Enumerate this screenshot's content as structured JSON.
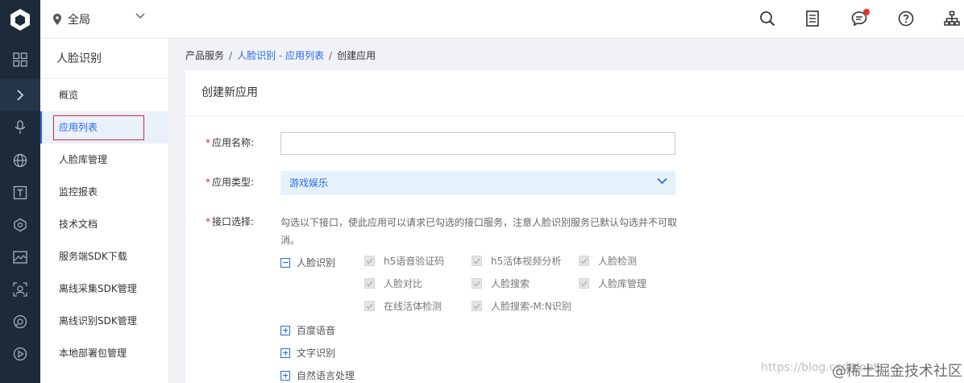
{
  "header": {
    "region": "全局",
    "icons": [
      "search-icon",
      "document-icon",
      "message-icon",
      "help-icon",
      "sitemap-icon"
    ]
  },
  "rail": {
    "icons": [
      "grid-icon",
      "expand-icon",
      "microphone-icon",
      "globe-icon",
      "text-icon",
      "cube-icon",
      "image-icon",
      "face-scan-icon",
      "eye-icon",
      "video-icon"
    ]
  },
  "sidenav": {
    "title": "人脸识别",
    "items": [
      {
        "label": "概览"
      },
      {
        "label": "应用列表",
        "active": true
      },
      {
        "label": "人脸库管理"
      },
      {
        "label": "监控报表"
      },
      {
        "label": "技术文档"
      },
      {
        "label": "服务端SDK下载"
      },
      {
        "label": "离线采集SDK管理"
      },
      {
        "label": "离线识别SDK管理"
      },
      {
        "label": "本地部署包管理"
      }
    ]
  },
  "breadcrumb": {
    "root": "产品服务",
    "parent": "人脸识别 - 应用列表",
    "current": "创建应用",
    "sep": "/"
  },
  "form": {
    "heading": "创建新应用",
    "required_mark": "*",
    "name_label": "应用名称:",
    "name_value": "",
    "type_label": "应用类型:",
    "type_value": "游戏娱乐",
    "api_label": "接口选择:",
    "api_hint": "勾选以下接口，使此应用可以请求已勾选的接口服务，注意人脸识别服务已默认勾选并不可取消。",
    "groups": [
      {
        "label": "人脸识别",
        "expanded": true
      },
      {
        "label": "百度语音",
        "expanded": false
      },
      {
        "label": "文字识别",
        "expanded": false
      },
      {
        "label": "自然语言处理",
        "expanded": false
      }
    ],
    "face_apis": [
      [
        "h5语音验证码",
        "h5活体视频分析",
        "人脸检测"
      ],
      [
        "人脸对比",
        "人脸搜索",
        "人脸库管理"
      ],
      [
        "在线活体检测",
        "人脸搜索-M:N识别"
      ]
    ]
  },
  "watermark": {
    "url": "https://blog.csdn.net",
    "brand": "@稀土掘金技术社区"
  }
}
